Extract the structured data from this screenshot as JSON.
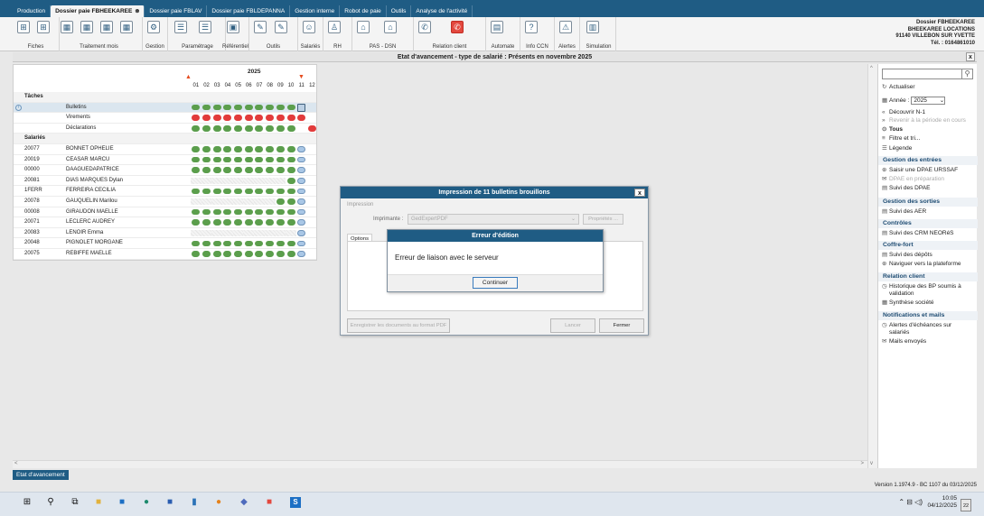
{
  "tabs": [
    {
      "label": "Production"
    },
    {
      "label": "Dossier paie FBHEEKAREE",
      "active": true
    },
    {
      "label": "Dossier paie FBLAV"
    },
    {
      "label": "Dossier paie FBLDEPANNA"
    },
    {
      "label": "Gestion interne"
    },
    {
      "label": "Robot de paie"
    },
    {
      "label": "Outils"
    },
    {
      "label": "Analyse de l'activité"
    }
  ],
  "ribbon": {
    "groups": [
      "Fiches",
      "Traitement mois",
      "Gestion",
      "Paramétrage",
      "Référentiel",
      "Outils",
      "Salariés",
      "RH",
      "PAS - DSN",
      "Relation client",
      "Automate",
      "Info CCN",
      "Alertes",
      "Simulation"
    ]
  },
  "company": {
    "name": "Dossier FBHEEKAREE",
    "line2": "BHEEKAREE LOCATIONS",
    "address": "91140 VILLEBON SUR YVETTE",
    "phone": "Tél. : 0164861010"
  },
  "page_title": "Etat d'avancement - type de salarié : Présents en novembre 2025",
  "grid": {
    "year": "2025",
    "months": [
      "01",
      "02",
      "03",
      "04",
      "05",
      "06",
      "07",
      "08",
      "09",
      "10",
      "11",
      "12"
    ],
    "section_taches": "Tâches",
    "section_salaries": "Salariés",
    "tasks": [
      {
        "name": "Bulletins",
        "cells": [
          "g",
          "g",
          "g",
          "g",
          "g",
          "g",
          "g",
          "g",
          "g",
          "g",
          "sq",
          ""
        ]
      },
      {
        "name": "Virements",
        "cells": [
          "r",
          "r",
          "r",
          "r",
          "r",
          "r",
          "r",
          "r",
          "r",
          "r",
          "r",
          ""
        ]
      },
      {
        "name": "Déclarations",
        "cells": [
          "g",
          "g",
          "g",
          "g",
          "g",
          "g",
          "g",
          "g",
          "g",
          "g",
          "",
          "r"
        ]
      }
    ],
    "employees": [
      {
        "code": "20077",
        "name": "BONNET OPHELIE",
        "cells": [
          "g",
          "g",
          "g",
          "g",
          "g",
          "g",
          "g",
          "g",
          "g",
          "g",
          "b",
          ""
        ]
      },
      {
        "code": "20019",
        "name": "CEASAR MARCU",
        "cells": [
          "g",
          "g",
          "g",
          "g",
          "g",
          "g",
          "g",
          "g",
          "g",
          "g",
          "b",
          ""
        ]
      },
      {
        "code": "00000",
        "name": "DAAGUEDAPATRICE",
        "cells": [
          "g",
          "g",
          "g",
          "g",
          "g",
          "g",
          "g",
          "g",
          "g",
          "g",
          "b",
          ""
        ]
      },
      {
        "code": "20081",
        "name": "DIAS MARQUES Dylan",
        "cells": [
          "h",
          "h",
          "h",
          "h",
          "h",
          "h",
          "h",
          "h",
          "h",
          "g",
          "b",
          ""
        ]
      },
      {
        "code": "1FERR",
        "name": "FERREIRA CECILIA",
        "cells": [
          "g",
          "g",
          "g",
          "g",
          "g",
          "g",
          "g",
          "g",
          "g",
          "g",
          "b",
          ""
        ]
      },
      {
        "code": "20078",
        "name": "GAUQUELIN Marilou",
        "cells": [
          "h",
          "h",
          "h",
          "h",
          "h",
          "h",
          "h",
          "h",
          "g",
          "g",
          "b",
          ""
        ]
      },
      {
        "code": "00008",
        "name": "GIRAUDON MAELLE",
        "cells": [
          "g",
          "g",
          "g",
          "g",
          "g",
          "g",
          "g",
          "g",
          "g",
          "g",
          "b",
          ""
        ]
      },
      {
        "code": "20071",
        "name": "LECLERC AUDREY",
        "cells": [
          "g",
          "g",
          "g",
          "g",
          "g",
          "g",
          "g",
          "g",
          "g",
          "g",
          "b",
          ""
        ]
      },
      {
        "code": "20083",
        "name": "LENOIR Emma",
        "cells": [
          "h",
          "h",
          "h",
          "h",
          "h",
          "h",
          "h",
          "h",
          "h",
          "h",
          "b",
          ""
        ]
      },
      {
        "code": "20048",
        "name": "PIGNOLET MORGANE",
        "cells": [
          "g",
          "g",
          "g",
          "g",
          "g",
          "g",
          "g",
          "g",
          "g",
          "g",
          "b",
          ""
        ]
      },
      {
        "code": "20075",
        "name": "REBIFFE MAELLE",
        "cells": [
          "g",
          "g",
          "g",
          "g",
          "g",
          "g",
          "g",
          "g",
          "g",
          "g",
          "b",
          ""
        ]
      }
    ]
  },
  "panel": {
    "actualiser": "Actualiser",
    "annee_label": "Année :",
    "annee_value": "2025",
    "decouvrir": "Découvrir N-1",
    "revenir": "Revenir à la période en cours",
    "tous": "Tous",
    "filtre": "Filtre et tri...",
    "legende": "Légende",
    "sec_entrees": "Gestion des entrées",
    "saisir_dpae": "Saisir une DPAE URSSAF",
    "dpae_prep": "DPAE en préparation",
    "suivi_dpae": "Suivi des DPAE",
    "sec_sorties": "Gestion des sorties",
    "suivi_aer": "Suivi des AER",
    "sec_controles": "Contrôles",
    "suivi_crm": "Suivi des CRM NEORéS",
    "sec_coffre": "Coffre-fort",
    "suivi_depots": "Suivi des dépôts",
    "naviguer": "Naviguer vers la plateforme",
    "sec_relation": "Relation client",
    "historique_1": "Historique des BP soumis à",
    "historique_2": "validation",
    "synthese": "Synthèse société",
    "sec_notif": "Notifications et mails",
    "alertes_1": "Alertes d'échéances sur",
    "alertes_2": "salariés",
    "mails": "Mails envoyés"
  },
  "dialog_print": {
    "title": "Impression de 11 bulletins brouillons",
    "group": "Impression",
    "printer_label": "Imprimante :",
    "printer_value": "GedExpertPDF",
    "properties": "Propriétés ...",
    "options_tab": "Options",
    "save_pdf": "Enregistrer les documents au format PDF",
    "cancel": "Lancer",
    "close": "Fermer"
  },
  "dialog_error": {
    "title": "Erreur d'édition",
    "message": "Erreur de liaison avec le serveur",
    "ok": "Continuer"
  },
  "status_tab": "Etat d'avancement",
  "version": "Version 1.1974.9 - BC 1107 du 03/12/2025",
  "clock": {
    "time": "10:05",
    "date": "04/12/2025"
  },
  "notif_count": "22",
  "colors": {
    "accent": "#1f5c84",
    "green": "#5b9e4c",
    "red": "#e23b3b",
    "blue": "#a9c7e6"
  }
}
